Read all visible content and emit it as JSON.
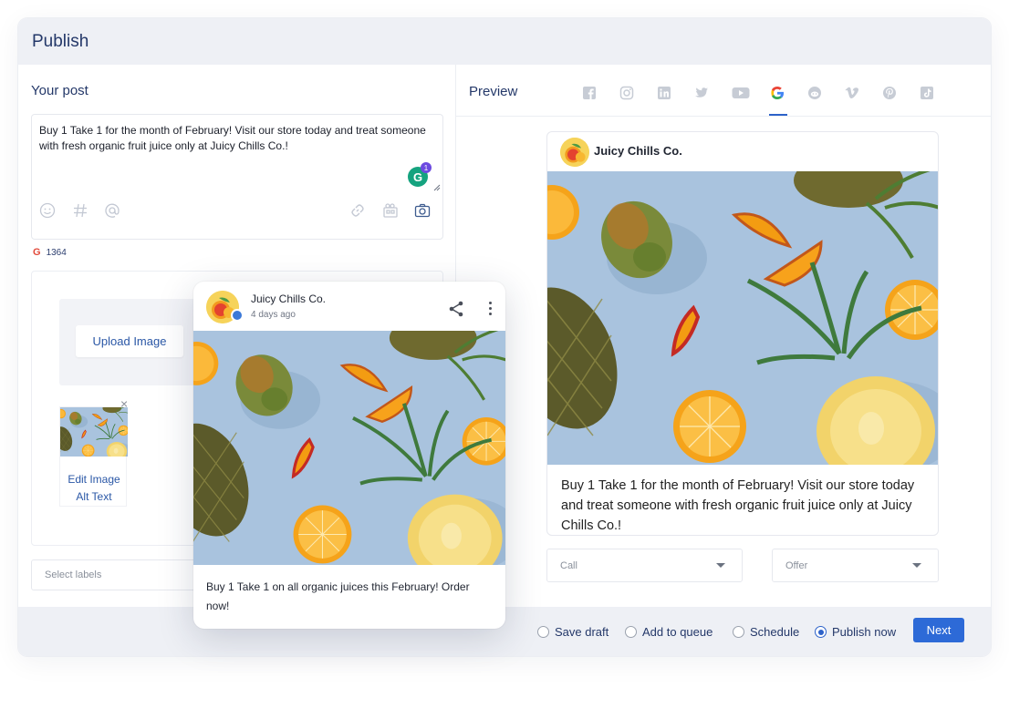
{
  "app": {
    "title": "Publish"
  },
  "composer": {
    "section_title": "Your post",
    "text": "Buy 1 Take 1 for the month of February! Visit our store today and treat someone with fresh organic fruit juice only at Juicy Chills Co.!",
    "grammarly_letter": "G",
    "grammarly_count": "1",
    "icons": [
      "emoji-icon",
      "hashtag-icon",
      "mention-icon",
      "link-icon",
      "media-library-icon",
      "camera-icon"
    ]
  },
  "counter": {
    "network_letter": "G",
    "value": "1364"
  },
  "media": {
    "upload_label": "Upload Image",
    "close_glyph": "×",
    "edit_alt_line1": "Edit Image",
    "edit_alt_line2": "Alt Text"
  },
  "labels": {
    "placeholder": "Select labels"
  },
  "preview": {
    "section_title": "Preview",
    "networks": [
      "facebook",
      "instagram",
      "linkedin",
      "twitter",
      "youtube",
      "google",
      "reddit",
      "vimeo",
      "pinterest",
      "tiktok"
    ],
    "active_network": "google",
    "card": {
      "name": "Juicy Chills Co.",
      "text": "Buy 1 Take 1 for the month of February! Visit our store today and treat someone with fresh organic fruit juice only at Juicy Chills Co.!"
    },
    "cta_button": {
      "value": "Call"
    },
    "cta_type": {
      "value": "Offer"
    }
  },
  "float_card": {
    "name": "Juicy Chills Co.",
    "time": "4 days ago",
    "text": "Buy 1 Take 1 on all organic juices this February! Order now!"
  },
  "footer": {
    "options": [
      {
        "label": "Save draft",
        "selected": false
      },
      {
        "label": "Add to queue",
        "selected": false
      },
      {
        "label": "Schedule",
        "selected": false
      },
      {
        "label": "Publish now",
        "selected": true
      }
    ],
    "next_label": "Next"
  },
  "colors": {
    "accent": "#2d6ad7",
    "header_bg": "#eef0f5",
    "title": "#243869",
    "image_bg": "#a9c3de"
  }
}
